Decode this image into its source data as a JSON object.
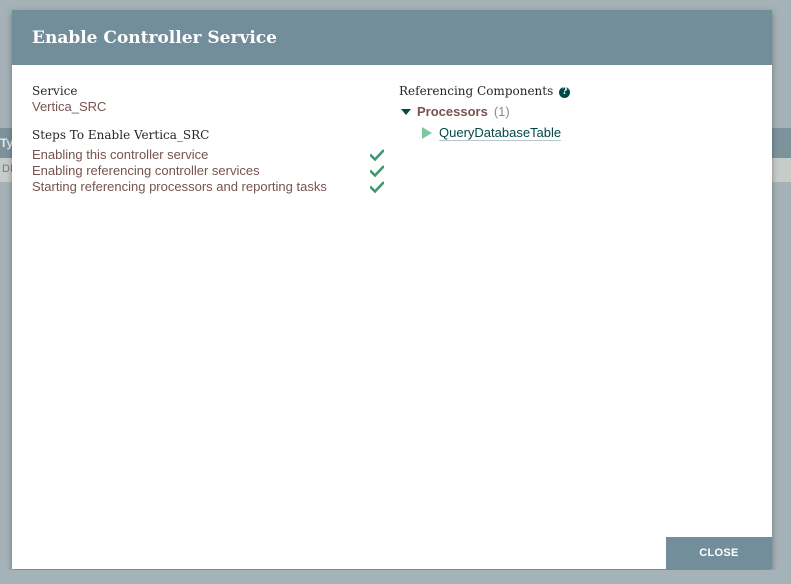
{
  "background": {
    "strip_text_a": "Ty",
    "strip_text_b": "DI"
  },
  "dialog": {
    "title": "Enable Controller Service",
    "service_label": "Service",
    "service_value": "Vertica_SRC",
    "steps_title": "Steps To Enable Vertica_SRC",
    "steps": [
      {
        "label": "Enabling this controller service",
        "status": "complete"
      },
      {
        "label": "Enabling referencing controller services",
        "status": "complete"
      },
      {
        "label": "Starting referencing processors and reporting tasks",
        "status": "complete"
      }
    ],
    "referencing_title": "Referencing Components",
    "help_icon": "question-circle-icon",
    "groups": [
      {
        "label": "Processors",
        "count": "(1)",
        "items": [
          {
            "name": "QueryDatabaseTable",
            "state_icon": "play-icon"
          }
        ]
      }
    ],
    "close_label": "CLOSE"
  },
  "colors": {
    "header": "#728e9b",
    "accent_text": "#775351",
    "link": "#004849",
    "check": "#3d9a72",
    "running": "#7dc7a0"
  }
}
